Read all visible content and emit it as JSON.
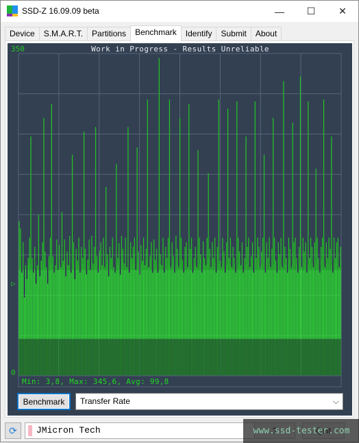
{
  "window": {
    "title": "SSD-Z 16.09.09 beta",
    "controls": {
      "minimize": "—",
      "maximize": "☐",
      "close": "✕"
    }
  },
  "tabs": [
    {
      "label": "Device",
      "active": false
    },
    {
      "label": "S.M.A.R.T.",
      "active": false
    },
    {
      "label": "Partitions",
      "active": false
    },
    {
      "label": "Benchmark",
      "active": true
    },
    {
      "label": "Identify",
      "active": false
    },
    {
      "label": "Submit",
      "active": false
    },
    {
      "label": "About",
      "active": false
    }
  ],
  "colors": {
    "panel_bg": "#334052",
    "grid": "#56657a",
    "bar_dark": "#1c8a1c",
    "bar_mid": "#22c822",
    "bar_bright": "#2af52a",
    "accent_blue": "#0b74c9"
  },
  "chart_data": {
    "type": "bar",
    "title": "Work in Progress - Results Unreliable",
    "xlabel": "",
    "ylabel": "Transfer Rate",
    "ylim": [
      0,
      350
    ],
    "y_ticks": [
      "350",
      "0"
    ],
    "avg_marker": "▷",
    "grid": true,
    "grid_divisions": 8,
    "stats": {
      "min": "3,8",
      "max": "345,6",
      "avg": "99,8"
    },
    "stats_text": "Min: 3,8, Max: 345,6, Avg: 99,8",
    "values": [
      168,
      160,
      112,
      145,
      85,
      120,
      105,
      128,
      150,
      260,
      128,
      112,
      140,
      100,
      120,
      175,
      108,
      125,
      145,
      280,
      135,
      118,
      100,
      130,
      150,
      295,
      130,
      112,
      120,
      148,
      115,
      142,
      118,
      178,
      125,
      148,
      108,
      135,
      120,
      152,
      112,
      240,
      145,
      105,
      138,
      125,
      150,
      112,
      140,
      128,
      265,
      138,
      110,
      126,
      148,
      115,
      152,
      122,
      140,
      270,
      130,
      112,
      136,
      145,
      120,
      150,
      118,
      205,
      132,
      108,
      140,
      128,
      150,
      118,
      112,
      230,
      128,
      144,
      110,
      152,
      138,
      122,
      150,
      118,
      270,
      112,
      145,
      128,
      140,
      150,
      115,
      248,
      135,
      110,
      142,
      125,
      150,
      120,
      138,
      300,
      118,
      130,
      145,
      112,
      148,
      126,
      138,
      112,
      345,
      132,
      120,
      150,
      112,
      140,
      128,
      150,
      300,
      118,
      145,
      130,
      112,
      152,
      138,
      118,
      280,
      150,
      126,
      112,
      140,
      145,
      118,
      295,
      138,
      150,
      112,
      128,
      140,
      118,
      245,
      150,
      132,
      112,
      146,
      128,
      120,
      150,
      220,
      138,
      118,
      145,
      128,
      150,
      112,
      140,
      300,
      125,
      118,
      150,
      135,
      112,
      145,
      290,
      128,
      150,
      118,
      140,
      128,
      112,
      298,
      150,
      135,
      120,
      145,
      112,
      128,
      260,
      140,
      150,
      118,
      130,
      145,
      112,
      298,
      128,
      150,
      140,
      118,
      135,
      150,
      240,
      112,
      145,
      128,
      150,
      118,
      138,
      280,
      150,
      125,
      112,
      145,
      132,
      150,
      118,
      320,
      140,
      128,
      112,
      150,
      138,
      118,
      275,
      145,
      150,
      128,
      112,
      140,
      325,
      118,
      150,
      135,
      145,
      112,
      298,
      128,
      150,
      140,
      118,
      145,
      225,
      150,
      128,
      112,
      140,
      150,
      300,
      118,
      145,
      128,
      150,
      138,
      260,
      112,
      150,
      128,
      145,
      150,
      118,
      140
    ],
    "bands": {
      "base_floor": 40,
      "dense_band_top": 115
    }
  },
  "controls": {
    "benchmark_button": "Benchmark",
    "mode_select": {
      "value": "Transfer Rate"
    }
  },
  "status": {
    "refresh_icon": "⟳",
    "drive_name": "JMicron Tech",
    "help_button": "?",
    "quit_button": "Quit",
    "watermark": "www.ssd-tester.com"
  }
}
